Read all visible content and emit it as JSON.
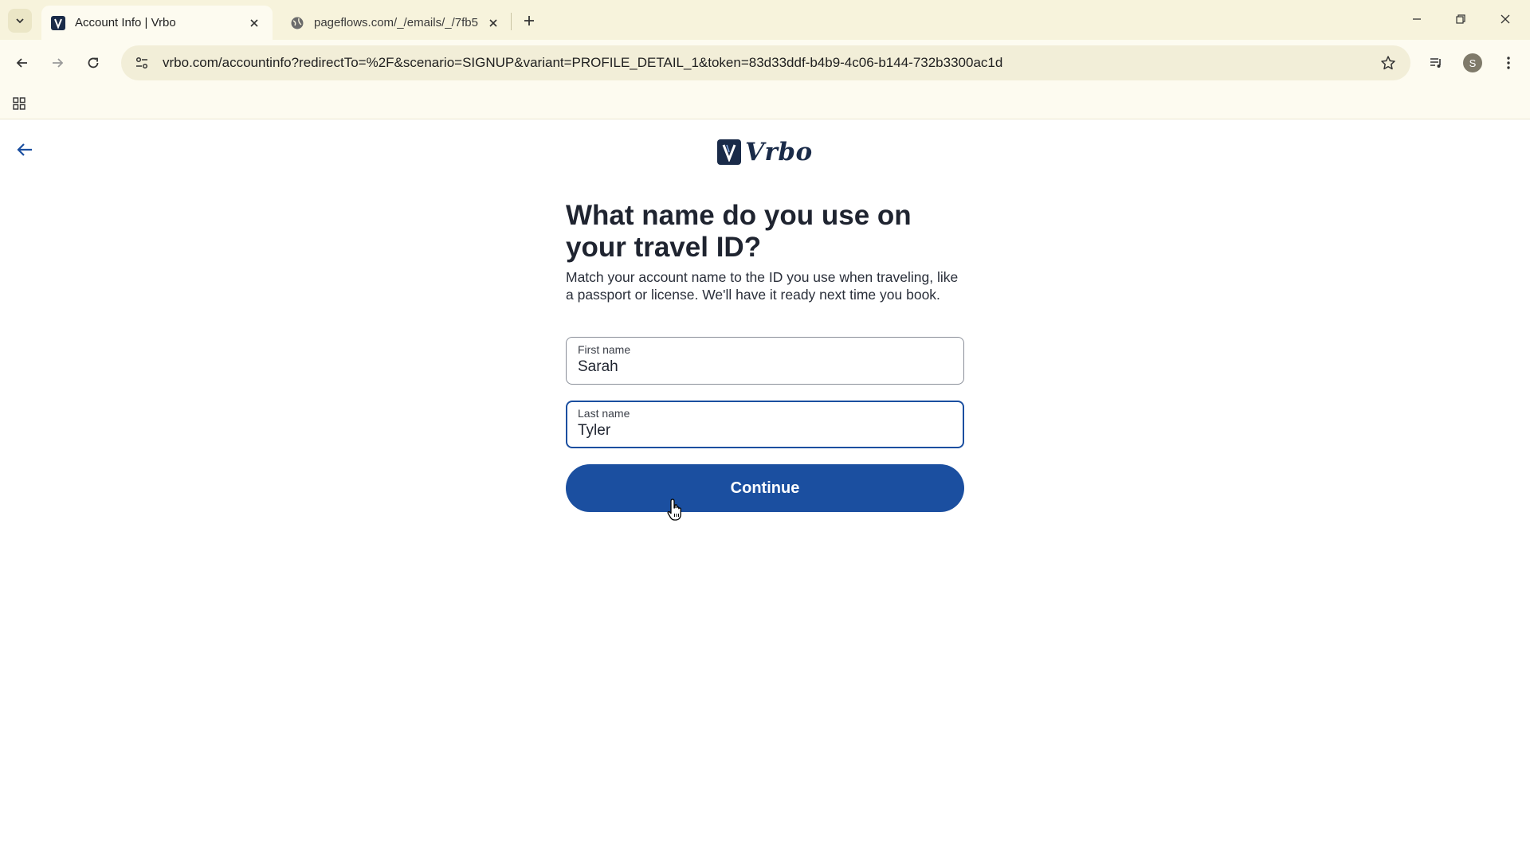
{
  "browser": {
    "tabs": [
      {
        "title": "Account Info | Vrbo",
        "active": true,
        "favicon": "vrbo-favicon"
      },
      {
        "title": "pageflows.com/_/emails/_/7fb5",
        "active": false,
        "favicon": "globe-icon"
      }
    ],
    "url": "vrbo.com/accountinfo?redirectTo=%2F&scenario=SIGNUP&variant=PROFILE_DETAIL_1&token=83d33ddf-b4b9-4c06-b144-732b3300ac1d",
    "profile_initial": "S"
  },
  "page": {
    "brand": "Vrbo",
    "heading": "What name do you use on your travel ID?",
    "subtext": "Match your account name to the ID you use when traveling, like a passport or license. We'll have it ready next time you book.",
    "first_name": {
      "label": "First name",
      "value": "Sarah"
    },
    "last_name": {
      "label": "Last name",
      "value": "Tyler"
    },
    "continue_label": "Continue"
  },
  "colors": {
    "brand_navy": "#1a2b49",
    "button_blue": "#1b4fa0",
    "chrome_bg": "#f7f3dc"
  }
}
